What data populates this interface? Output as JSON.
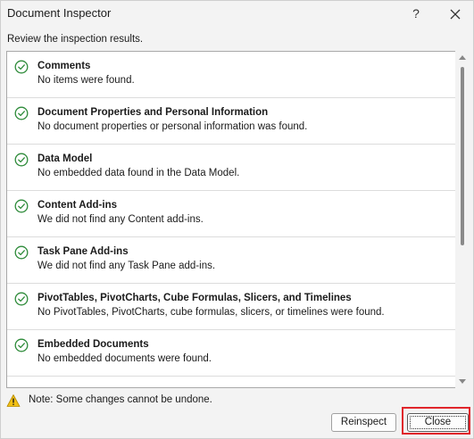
{
  "window": {
    "title": "Document Inspector",
    "help_label": "?"
  },
  "subtitle": "Review the inspection results.",
  "results": [
    {
      "title": "Comments",
      "description": "No items were found.",
      "status": "ok"
    },
    {
      "title": "Document Properties and Personal Information",
      "description": "No document properties or personal information was found.",
      "status": "ok"
    },
    {
      "title": "Data Model",
      "description": "No embedded data found in the Data Model.",
      "status": "ok"
    },
    {
      "title": "Content Add-ins",
      "description": "We did not find any Content add-ins.",
      "status": "ok"
    },
    {
      "title": "Task Pane Add-ins",
      "description": "We did not find any Task Pane add-ins.",
      "status": "ok"
    },
    {
      "title": "PivotTables, PivotCharts, Cube Formulas, Slicers, and Timelines",
      "description": "No PivotTables, PivotCharts, cube formulas, slicers, or timelines were found.",
      "status": "ok"
    },
    {
      "title": "Embedded Documents",
      "description": "No embedded documents were found.",
      "status": "ok"
    }
  ],
  "note": "Note: Some changes cannot be undone.",
  "buttons": {
    "reinspect": "Reinspect",
    "close": "Close"
  },
  "colors": {
    "check": "#2e8b3a",
    "warning_fill": "#f2c014",
    "highlight": "#e0252b"
  },
  "icons": {
    "status_ok": "check-circle-icon",
    "note": "warning-icon",
    "close": "close-icon"
  }
}
